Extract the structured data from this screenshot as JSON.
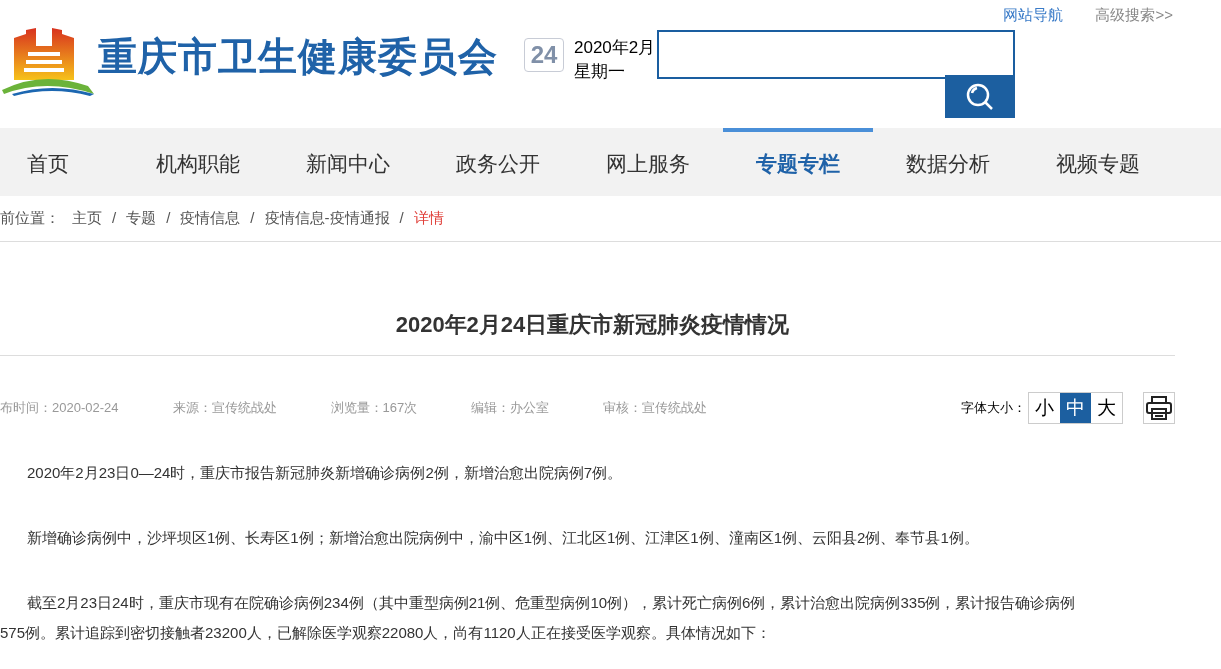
{
  "top_links": [
    {
      "label": "网站导航",
      "kind": "primary"
    },
    {
      "label": "高级搜索>>",
      "kind": "muted"
    }
  ],
  "site_title": "重庆市卫生健康委员会",
  "date": {
    "day": "24",
    "month": "2020年2月",
    "weekday": "星期一"
  },
  "nav": [
    {
      "label": "首页",
      "selected": false
    },
    {
      "label": "机构职能",
      "selected": false
    },
    {
      "label": "新闻中心",
      "selected": false
    },
    {
      "label": "政务公开",
      "selected": false
    },
    {
      "label": "网上服务",
      "selected": false
    },
    {
      "label": "专题专栏",
      "selected": true
    },
    {
      "label": "数据分析",
      "selected": false
    },
    {
      "label": "视频专题",
      "selected": false
    }
  ],
  "breadcrumb": {
    "label": "前位置：",
    "items": [
      {
        "label": "主页",
        "current": false
      },
      {
        "label": "专题",
        "current": false
      },
      {
        "label": "疫情信息",
        "current": false
      },
      {
        "label": "疫情信息-疫情通报",
        "current": false
      },
      {
        "label": "详情",
        "current": true
      }
    ],
    "separator": "/"
  },
  "article": {
    "title": "2020年2月24日重庆市新冠肺炎疫情情况",
    "meta": [
      "布时间：2020-02-24",
      "来源：宣传统战处",
      "浏览量：167次",
      "编辑：办公室",
      "审核：宣传统战处"
    ],
    "font_size": {
      "label": "字体大小：",
      "options": [
        {
          "label": "小",
          "selected": false
        },
        {
          "label": "中",
          "selected": true
        },
        {
          "label": "大",
          "selected": false
        }
      ]
    },
    "paragraphs": [
      {
        "lines": [
          "2020年2月23日0—24时，重庆市报告新冠肺炎新增确诊病例2例，新增治愈出院病例7例。"
        ]
      },
      {
        "lines": [
          "新增确诊病例中，沙坪坝区1例、长寿区1例；新增治愈出院病例中，渝中区1例、江北区1例、江津区1例、潼南区1例、云阳县2例、奉节县1例。"
        ]
      },
      {
        "lines": [
          "截至2月23日24时，重庆市现有在院确诊病例234例（其中重型病例21例、危重型病例10例），累计死亡病例6例，累计治愈出院病例335例，累计报告确诊病例",
          "575例。累计追踪到密切接触者23200人，已解除医学观察22080人，尚有1120人正在接受医学观察。具体情况如下："
        ]
      }
    ]
  }
}
